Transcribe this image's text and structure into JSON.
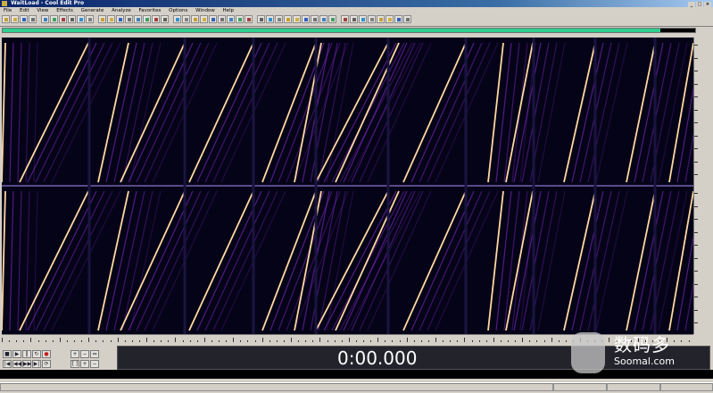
{
  "window": {
    "title": "WaitLoad - Cool Edit Pro"
  },
  "menu": [
    "File",
    "Edit",
    "View",
    "Effects",
    "Generate",
    "Analyze",
    "Favorites",
    "Options",
    "Window",
    "Help"
  ],
  "overview": {
    "progress": 0.95,
    "color": "#2ecf8e"
  },
  "spectrogram": {
    "channels": 2,
    "background": "#050318",
    "sweep_color": "#ffd8a0",
    "harmonic_color": "#8a2ccf"
  },
  "time_display": {
    "value": "0:00.000"
  },
  "icons": [
    "new-icon",
    "open-icon",
    "save-icon",
    "cut-icon",
    "copy-icon",
    "paste-icon",
    "zoom-icon",
    "play-icon",
    "stop-icon",
    "pause-icon",
    "record-icon",
    "rewind-icon",
    "fast-forward-icon"
  ]
}
